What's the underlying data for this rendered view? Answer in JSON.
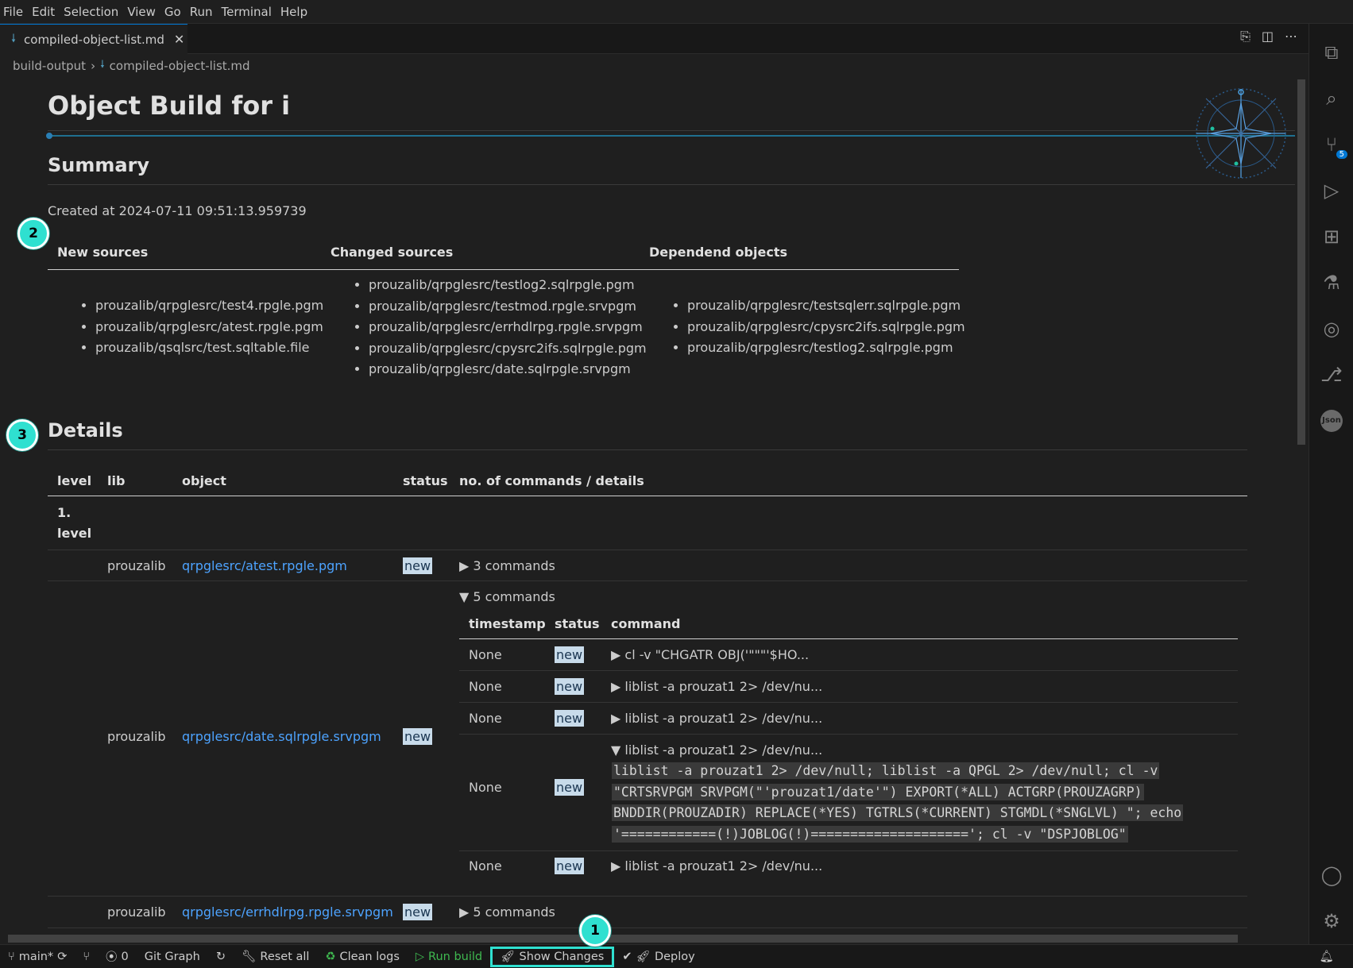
{
  "menu": [
    "File",
    "Edit",
    "Selection",
    "View",
    "Go",
    "Run",
    "Terminal",
    "Help"
  ],
  "tab": {
    "name": "compiled-object-list.md",
    "close": "✕"
  },
  "breadcrumb": {
    "folder": "build-output",
    "sep": "›",
    "file": "compiled-object-list.md"
  },
  "doc": {
    "title": "Object Build for i",
    "summary_heading": "Summary",
    "created": "Created at 2024-07-11 09:51:13.959739",
    "summary": {
      "new_header": "New sources",
      "changed_header": "Changed sources",
      "dep_header": "Dependend objects",
      "new_sources": [
        "prouzalib/qrpglesrc/test4.rpgle.pgm",
        "prouzalib/qrpglesrc/atest.rpgle.pgm",
        "prouzalib/qsqlsrc/test.sqltable.file"
      ],
      "changed_sources": [
        "prouzalib/qrpglesrc/testlog2.sqlrpgle.pgm",
        "prouzalib/qrpglesrc/testmod.rpgle.srvpgm",
        "prouzalib/qrpglesrc/errhdlrpg.rpgle.srvpgm",
        "prouzalib/qrpglesrc/cpysrc2ifs.sqlrpgle.pgm",
        "prouzalib/qrpglesrc/date.sqlrpgle.srvpgm"
      ],
      "dependend_objects": [
        "prouzalib/qrpglesrc/testsqlerr.sqlrpgle.pgm",
        "prouzalib/qrpglesrc/cpysrc2ifs.sqlrpgle.pgm",
        "prouzalib/qrpglesrc/testlog2.sqlrpgle.pgm"
      ]
    },
    "details_heading": "Details",
    "table_headers": {
      "level": "level",
      "lib": "lib",
      "object": "object",
      "status": "status",
      "details": "no. of commands / details"
    },
    "level_label": [
      "1.",
      "level"
    ],
    "rows": [
      {
        "lib": "prouzalib",
        "object": "qrpglesrc/atest.rpgle.pgm",
        "status": "new",
        "commands": "▶ 3 commands"
      },
      {
        "lib": "prouzalib",
        "object": "qrpglesrc/date.sqlrpgle.srvpgm",
        "status": "new",
        "commands": "▼ 5 commands"
      },
      {
        "lib": "prouzalib",
        "object": "qrpglesrc/errhdlrpg.rpgle.srvpgm",
        "status": "new",
        "commands": "▶ 5 commands"
      }
    ],
    "sub_headers": {
      "timestamp": "timestamp",
      "status": "status",
      "command": "command"
    },
    "sub_rows": [
      {
        "timestamp": "None",
        "status": "new",
        "command": "▶ cl -v \"CHGATR OBJ('\"\"\"'$HO..."
      },
      {
        "timestamp": "None",
        "status": "new",
        "command": "▶ liblist -a prouzat1 2> /dev/nu..."
      },
      {
        "timestamp": "None",
        "status": "new",
        "command": "▶ liblist -a prouzat1 2> /dev/nu..."
      },
      {
        "timestamp": "None",
        "status": "new",
        "command": "▼ liblist -a prouzat1 2> /dev/nu..."
      },
      {
        "timestamp": "None",
        "status": "new",
        "command": "▶ liblist -a prouzat1 2> /dev/nu..."
      }
    ],
    "expanded_code": [
      "liblist -a prouzat1 2> /dev/null; liblist -a QPGL 2> /dev/null; cl -v",
      "\"CRTSRVPGM SRVPGM(\"'prouzat1/date'\") EXPORT(*ALL) ACTGRP(PROUZAGRP)",
      "BNDDIR(PROUZADIR) REPLACE(*YES) TGTRLS(*CURRENT) STGMDL(*SNGLVL) \"; echo",
      "'============(!)JOBLOG(!)===================='; cl -v \"DSPJOBLOG\""
    ]
  },
  "markers": [
    "1",
    "2",
    "3"
  ],
  "activity_badge": "5",
  "activity_json_label": "Json",
  "statusbar": {
    "branch": "main*",
    "ports": "0",
    "git_graph": "Git Graph",
    "reset_all": "Reset all",
    "clean_logs": "Clean logs",
    "run_build": "Run build",
    "show_changes": "Show Changes",
    "deploy": "Deploy"
  },
  "colors": {
    "accent": "#0078d4",
    "marker": "#2fe0d0",
    "link": "#4da3ff",
    "badge": "#c8dbea",
    "run": "#3fb950"
  }
}
